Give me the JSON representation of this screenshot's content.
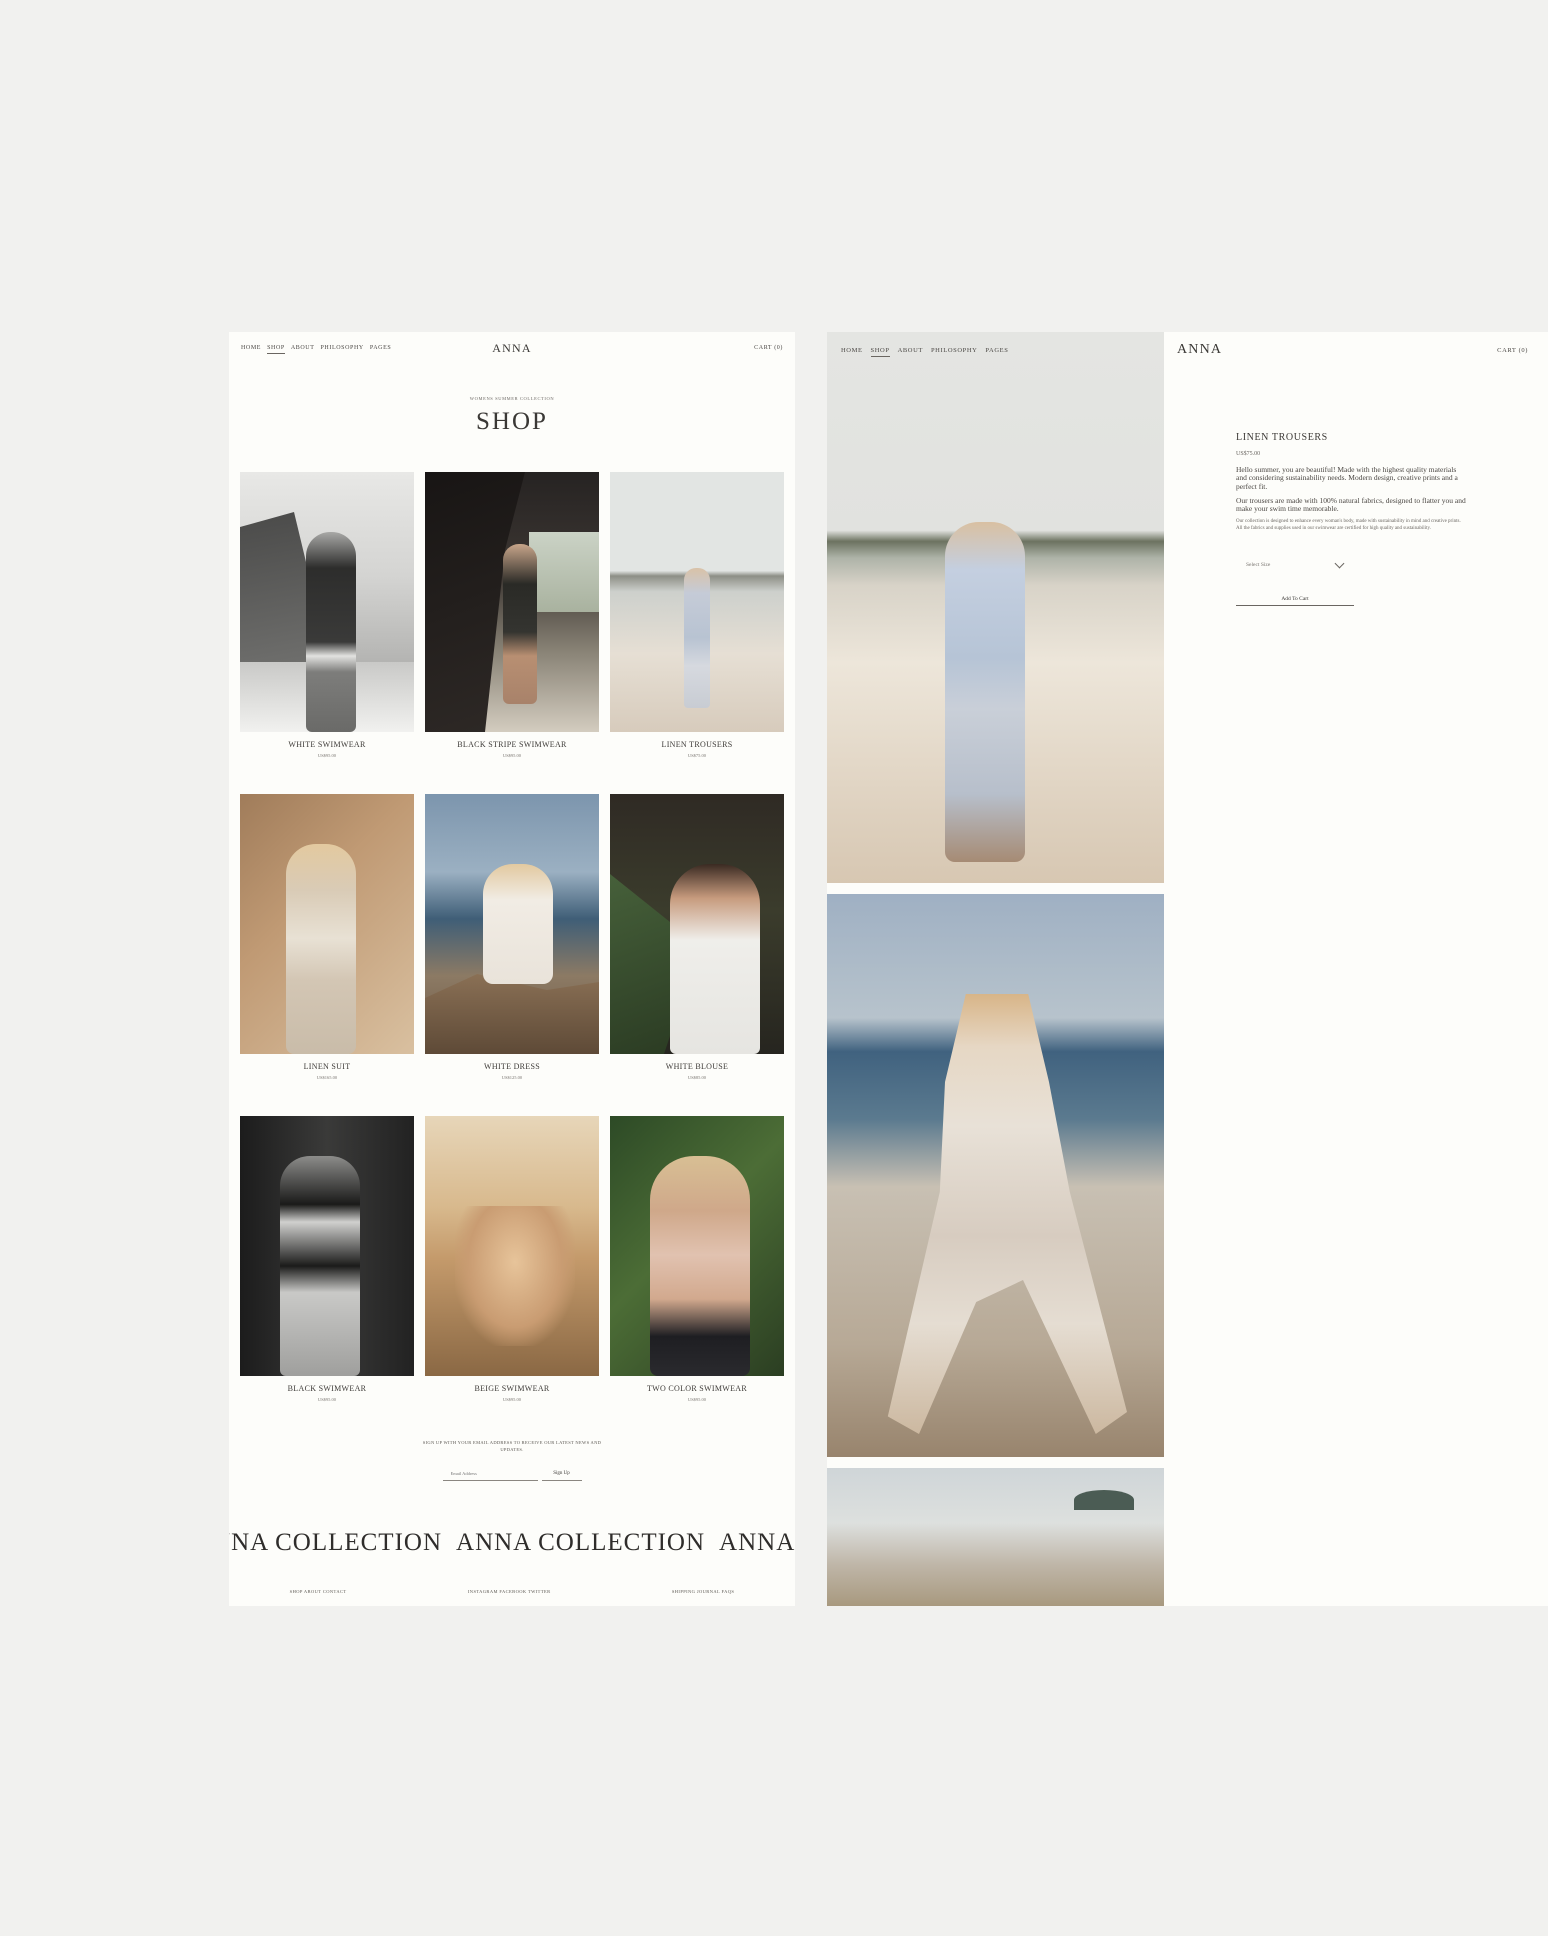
{
  "shop_page": {
    "nav": {
      "links": [
        "HOME",
        "SHOP",
        "ABOUT",
        "PHILOSOPHY",
        "PAGES"
      ],
      "active": "SHOP",
      "logo": "ANNA",
      "cart": "CART (0)"
    },
    "eyebrow": "WOMENS SUMMER COLLECTION",
    "title": "SHOP",
    "products": [
      {
        "name": "WHITE SWIMWEAR",
        "price": "US$95.00"
      },
      {
        "name": "BLACK STRIPE SWIMWEAR",
        "price": "US$95.00"
      },
      {
        "name": "LINEN TROUSERS",
        "price": "US$75.00"
      },
      {
        "name": "LINEN SUIT",
        "price": "US$165.00"
      },
      {
        "name": "WHITE DRESS",
        "price": "US$125.00"
      },
      {
        "name": "WHITE BLOUSE",
        "price": "US$85.00"
      },
      {
        "name": "BLACK SWIMWEAR",
        "price": "US$95.00"
      },
      {
        "name": "BEIGE SWIMWEAR",
        "price": "US$95.00"
      },
      {
        "name": "TWO COLOR SWIMWEAR",
        "price": "US$95.00"
      }
    ],
    "newsletter": {
      "text": "SIGN UP WITH YOUR EMAIL ADDRESS TO RECEIVE OUR LATEST NEWS AND UPDATES.",
      "placeholder": "Email Address",
      "button": "Sign Up"
    },
    "marquee": [
      "ANNA COLLECTION",
      "ANNA COLLECTION",
      "ANNA COLLECTION"
    ],
    "footer": [
      "SHOP  ABOUT  CONTACT",
      "INSTAGRAM  FACEBOOK  TWITTER",
      "SHIPPING  JOURNAL  FAQS"
    ]
  },
  "product_page": {
    "nav": {
      "links": [
        "HOME",
        "SHOP",
        "ABOUT",
        "PHILOSOPHY",
        "PAGES"
      ],
      "active": "SHOP",
      "logo": "ANNA",
      "cart": "CART (0)"
    },
    "title": "LINEN TROUSERS",
    "price": "US$75.00",
    "lead": "Hello summer, you are beautiful! Made with the highest quality materials and considering sustainability needs. Modern design, creative prints and a perfect fit.",
    "body": "Our trousers are made with 100% natural fabrics, designed to flatter you and make your swim time memorable.",
    "small": "Our collection is designed to enhance every woman's body, made with sustainability in mind and creative prints. All the fabrics and supplies used in our swimwear are certified for high quality and sustainability.",
    "size_placeholder": "Select Size",
    "add_to_cart": "Add To Cart"
  }
}
